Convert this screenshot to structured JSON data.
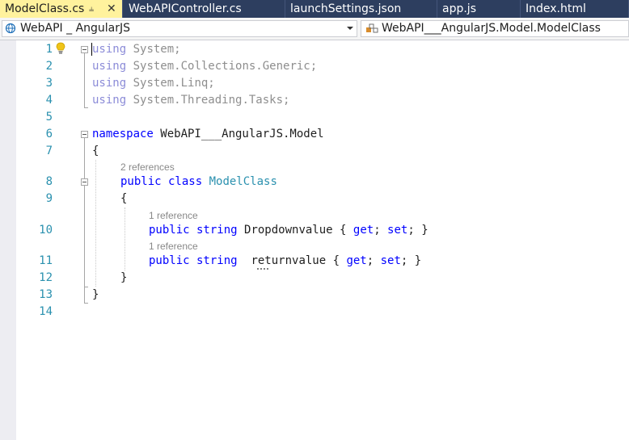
{
  "tabs": [
    {
      "label": "ModelClass.cs",
      "active": true
    },
    {
      "label": "WebAPIController.cs",
      "active": false
    },
    {
      "label": "launchSettings.json",
      "active": false
    },
    {
      "label": "app.js",
      "active": false
    },
    {
      "label": "Index.html",
      "active": false
    }
  ],
  "nav": {
    "project": "WebAPI _ AngularJS",
    "type_scope": "WebAPI___AngularJS.Model.ModelClass"
  },
  "editor": {
    "line_numbers": [
      "1",
      "2",
      "3",
      "4",
      "5",
      "6",
      "7",
      "8",
      "9",
      "10",
      "11",
      "12",
      "13",
      "14"
    ],
    "lines": {
      "l1_using": "using",
      "l1_rest": " System;",
      "l2_using": "using",
      "l2_rest": " System.Collections.Generic;",
      "l3_using": "using",
      "l3_rest": " System.Linq;",
      "l4_using": "using",
      "l4_rest": " System.Threading.Tasks;",
      "l6_namespace": "namespace",
      "l6_rest": " WebAPI___AngularJS.Model",
      "l7_brace": "{",
      "l8_public": "public",
      "l8_class": " class ",
      "l8_name": "ModelClass",
      "l9_brace": "{",
      "l10_public": "public",
      "l10_string": " string",
      "l10_name": " Dropdownvalue { ",
      "l10_get": "get",
      "l10_mid": "; ",
      "l10_set": "set",
      "l10_end": "; }",
      "l11_public": "public",
      "l11_string": " string",
      "l11_name": "  returnvalue { ",
      "l11_get": "get",
      "l11_mid": "; ",
      "l11_set": "set",
      "l11_end": "; }",
      "l12_brace": "}",
      "l13_brace": "}"
    },
    "codelens": {
      "class_refs": "2 references",
      "prop1_refs": "1 reference",
      "prop2_refs": "1 reference"
    }
  },
  "colors": {
    "tabbar": "#2d3e5f",
    "active_tab": "#fff29d",
    "keyword": "#0000ff",
    "type": "#2b91af",
    "line_number": "#2b91af"
  }
}
